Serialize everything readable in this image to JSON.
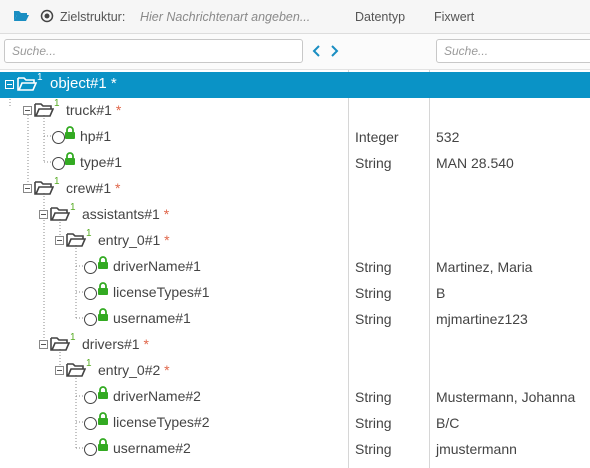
{
  "header": {
    "target_label": "Zielstruktur:",
    "target_placeholder": "Hier Nachrichtenart angeben...",
    "col_type": "Datentyp",
    "col_value": "Fixwert",
    "open_icon": "folder-open-icon",
    "target_icon": "target-radio-icon"
  },
  "filters": {
    "tree_search_placeholder": "Suche...",
    "value_search_placeholder": "Suche...",
    "prev_icon": "chevron-left-icon",
    "next_icon": "chevron-right-icon"
  },
  "colors": {
    "selected_row": "#0a93c6",
    "nav_arrow": "#1a8ec2",
    "folder": "#444444",
    "cardinality": "#55aa22",
    "lock": "#33aa22",
    "required_star": "#e0664a"
  },
  "tree": [
    {
      "label": "object#1",
      "cardinality": "1",
      "required": "*",
      "type": "",
      "value": "",
      "kind": "folder",
      "level": 0,
      "selected": true
    },
    {
      "label": "truck#1",
      "cardinality": "1",
      "required": "*",
      "type": "",
      "value": "",
      "kind": "folder",
      "level": 1
    },
    {
      "label": "hp#1",
      "cardinality": "",
      "required": "",
      "type": "Integer",
      "value": "532",
      "kind": "leaf",
      "level": 2
    },
    {
      "label": "type#1",
      "cardinality": "",
      "required": "",
      "type": "String",
      "value": "MAN 28.540",
      "kind": "leaf",
      "level": 2
    },
    {
      "label": "crew#1",
      "cardinality": "1",
      "required": "*",
      "type": "",
      "value": "",
      "kind": "folder",
      "level": 1
    },
    {
      "label": "assistants#1",
      "cardinality": "1",
      "required": "*",
      "type": "",
      "value": "",
      "kind": "folder",
      "level": 2
    },
    {
      "label": "entry_0#1",
      "cardinality": "1",
      "required": "*",
      "type": "",
      "value": "",
      "kind": "folder",
      "level": 3
    },
    {
      "label": "driverName#1",
      "cardinality": "",
      "required": "",
      "type": "String",
      "value": "Martinez, Maria",
      "kind": "leaf",
      "level": 4
    },
    {
      "label": "licenseTypes#1",
      "cardinality": "",
      "required": "",
      "type": "String",
      "value": "B",
      "kind": "leaf",
      "level": 4
    },
    {
      "label": "username#1",
      "cardinality": "",
      "required": "",
      "type": "String",
      "value": "mjmartinez123",
      "kind": "leaf",
      "level": 4
    },
    {
      "label": "drivers#1",
      "cardinality": "1",
      "required": "*",
      "type": "",
      "value": "",
      "kind": "folder",
      "level": 2
    },
    {
      "label": "entry_0#2",
      "cardinality": "1",
      "required": "*",
      "type": "",
      "value": "",
      "kind": "folder",
      "level": 3
    },
    {
      "label": "driverName#2",
      "cardinality": "",
      "required": "",
      "type": "String",
      "value": "Mustermann, Johanna",
      "kind": "leaf",
      "level": 4
    },
    {
      "label": "licenseTypes#2",
      "cardinality": "",
      "required": "",
      "type": "String",
      "value": "B/C",
      "kind": "leaf",
      "level": 4
    },
    {
      "label": "username#2",
      "cardinality": "",
      "required": "",
      "type": "String",
      "value": "jmustermann",
      "kind": "leaf",
      "level": 4
    }
  ]
}
